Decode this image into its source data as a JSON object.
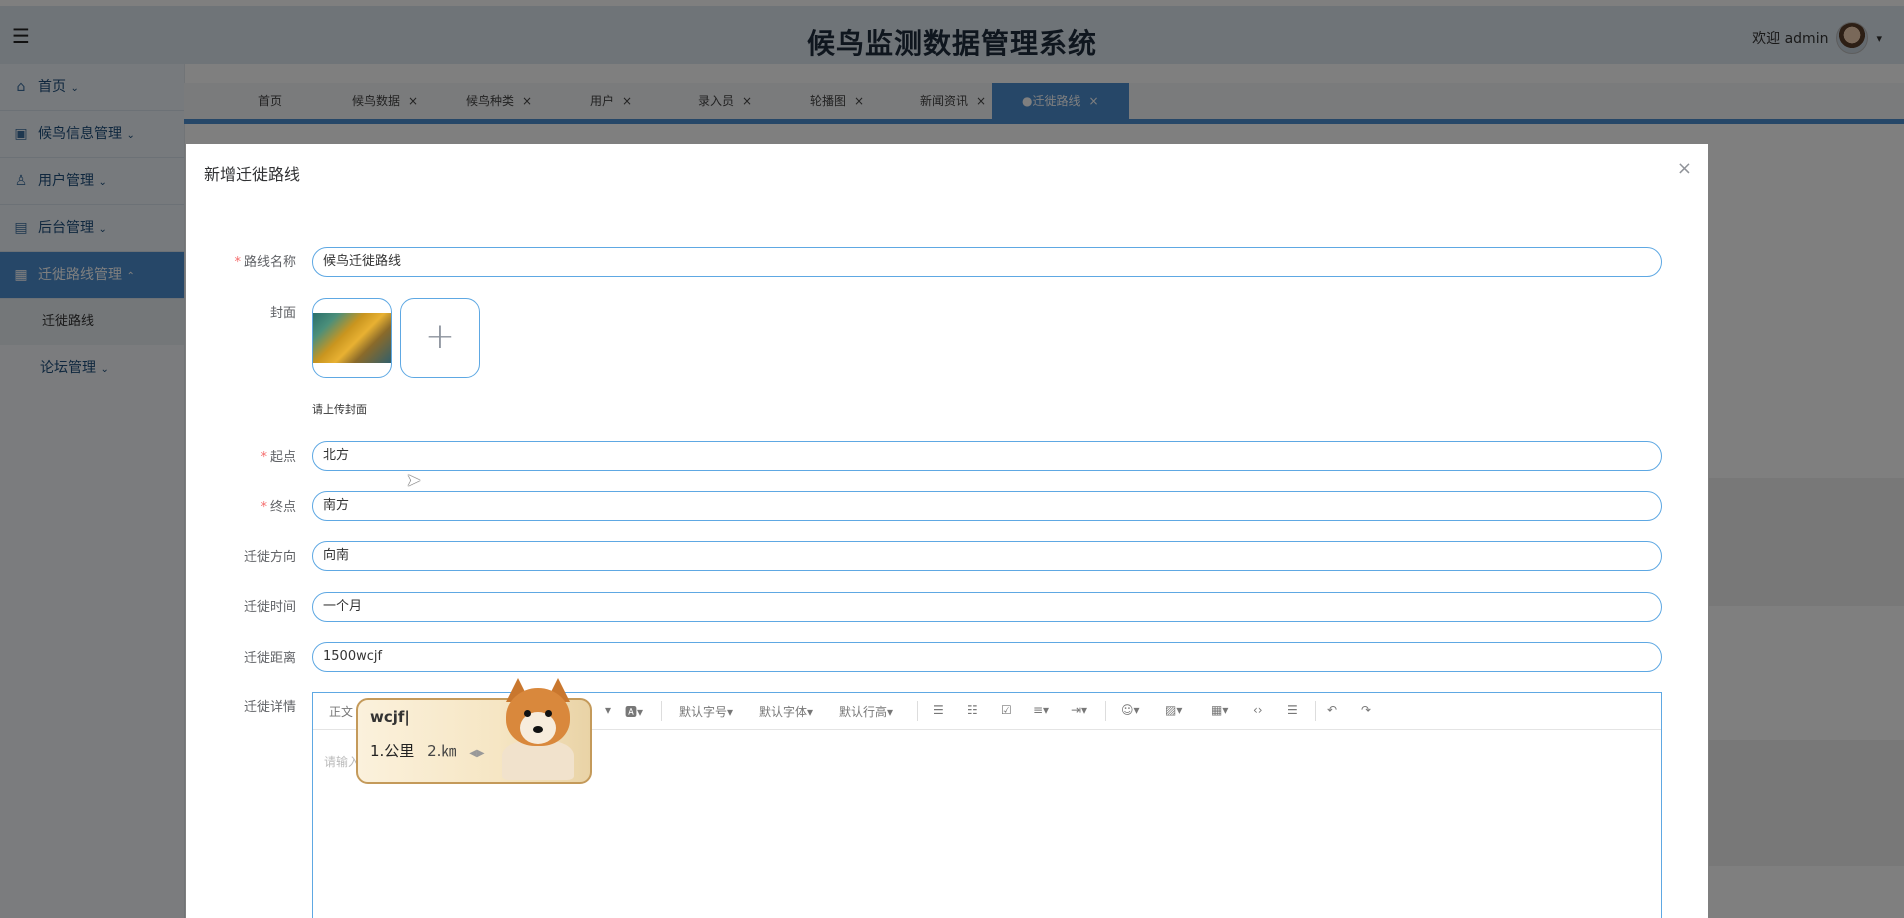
{
  "header": {
    "menu_icon": "hamburger-icon",
    "title": "候鸟监测数据管理系统",
    "welcome": "欢迎 admin"
  },
  "sidebar": {
    "items": [
      {
        "label": "首页",
        "icon": "home-icon"
      },
      {
        "label": "候鸟信息管理",
        "icon": "module-icon"
      },
      {
        "label": "用户管理",
        "icon": "user-icon"
      },
      {
        "label": "后台管理",
        "icon": "panel-icon"
      },
      {
        "label": "迁徙路线管理",
        "icon": "grid-icon"
      }
    ],
    "sub_item": "迁徙路线",
    "last_item": "论坛管理"
  },
  "tabs": [
    {
      "label": "首页"
    },
    {
      "label": "候鸟数据"
    },
    {
      "label": "候鸟种类"
    },
    {
      "label": "用户"
    },
    {
      "label": "录入员"
    },
    {
      "label": "轮播图"
    },
    {
      "label": "新闻资讯"
    },
    {
      "label": "●迁徙路线"
    }
  ],
  "tab_close": "×",
  "dialog": {
    "title": "新增迁徙路线",
    "close": "×",
    "fields": {
      "route_name": {
        "label": "路线名称",
        "value": "候鸟迁徙路线",
        "required": true
      },
      "cover": {
        "label": "封面",
        "tip": "请上传封面"
      },
      "start": {
        "label": "起点",
        "value": "北方",
        "required": true
      },
      "end": {
        "label": "终点",
        "value": "南方",
        "required": true
      },
      "direction": {
        "label": "迁徙方向",
        "value": "向南"
      },
      "time": {
        "label": "迁徙时间",
        "value": "一个月"
      },
      "distance": {
        "label": "迁徙距离",
        "value": "1500wcjf"
      },
      "detail": {
        "label": "迁徙详情",
        "placeholder": "请输入..."
      }
    },
    "required_mark": "*"
  },
  "editor_toolbar": {
    "paragraph": "正文",
    "font_size": "默认字号",
    "font_family": "默认字体",
    "line_height": "默认行高"
  },
  "ime": {
    "input": "wcjf|",
    "candidate_1": "1.公里",
    "candidate_2": "2.㎞",
    "arrow": "◀▶"
  },
  "colors": {
    "accent": "#4c8ed0",
    "input_border": "#5ea8e3",
    "required": "#f56c6c"
  }
}
